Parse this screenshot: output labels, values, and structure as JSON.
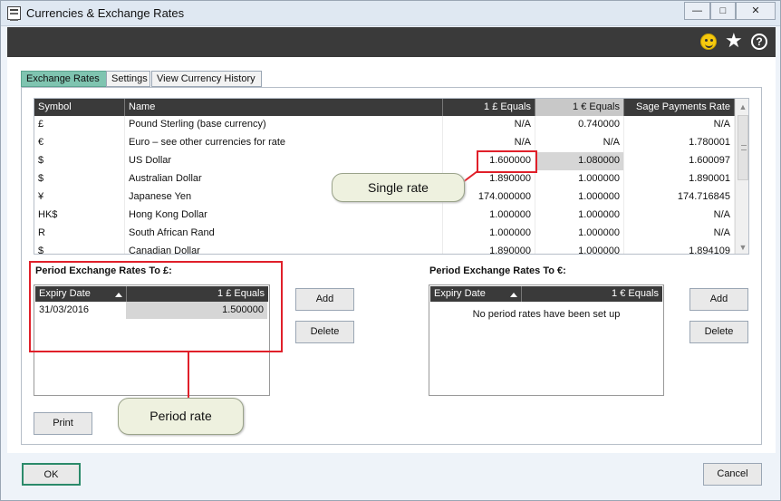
{
  "window": {
    "title": "Currencies & Exchange Rates",
    "min_glyph": "—",
    "max_glyph": "□",
    "close_glyph": "✕"
  },
  "toolbar": {
    "icons": [
      "smiley-icon",
      "star-icon",
      "help-icon"
    ],
    "help_glyph": "?",
    "star_glyph": "★"
  },
  "tabs": [
    {
      "label": "Exchange Rates",
      "active": true
    },
    {
      "label": "Settings",
      "active": false
    },
    {
      "label": "View Currency History",
      "active": false
    }
  ],
  "currency_grid": {
    "columns": [
      "Symbol",
      "Name",
      "1 £ Equals",
      "1 € Equals",
      "Sage Payments Rate"
    ],
    "selected_column": "1 € Equals",
    "rows": [
      [
        "£",
        "Pound Sterling (base currency)",
        "N/A",
        "0.740000",
        "N/A"
      ],
      [
        "€",
        "Euro – see other currencies for rate",
        "N/A",
        "N/A",
        "1.780001"
      ],
      [
        "$",
        "US Dollar",
        "1.600000",
        "1.080000",
        "1.600097"
      ],
      [
        "$",
        "Australian Dollar",
        "1.890000",
        "1.000000",
        "1.890001"
      ],
      [
        "¥",
        "Japanese Yen",
        "174.000000",
        "1.000000",
        "174.716845"
      ],
      [
        "HK$",
        "Hong Kong Dollar",
        "1.000000",
        "1.000000",
        "N/A"
      ],
      [
        "R",
        "South African Rand",
        "1.000000",
        "1.000000",
        "N/A"
      ],
      [
        "$",
        "Canadian Dollar",
        "1.890000",
        "1.000000",
        "1.894109"
      ]
    ]
  },
  "annotations": {
    "single_rate": "Single rate",
    "period_rate": "Period rate",
    "accent_color": "#e0202a"
  },
  "period_gbp": {
    "label": "Period Exchange Rates To £:",
    "columns": [
      "Expiry Date",
      "1 £ Equals"
    ],
    "rows": [
      [
        "31/03/2016",
        "1.500000"
      ]
    ],
    "add_label": "Add",
    "delete_label": "Delete"
  },
  "period_eur": {
    "label": "Period Exchange Rates To €:",
    "columns": [
      "Expiry Date",
      "1 € Equals"
    ],
    "empty_message": "No period rates have been set up",
    "add_label": "Add",
    "delete_label": "Delete"
  },
  "buttons": {
    "print": "Print",
    "ok": "OK",
    "cancel": "Cancel"
  },
  "colors": {
    "active_tab": "#7fc4b0",
    "header_bg": "#3a3a3a",
    "ok_border": "#2b8a6a"
  }
}
